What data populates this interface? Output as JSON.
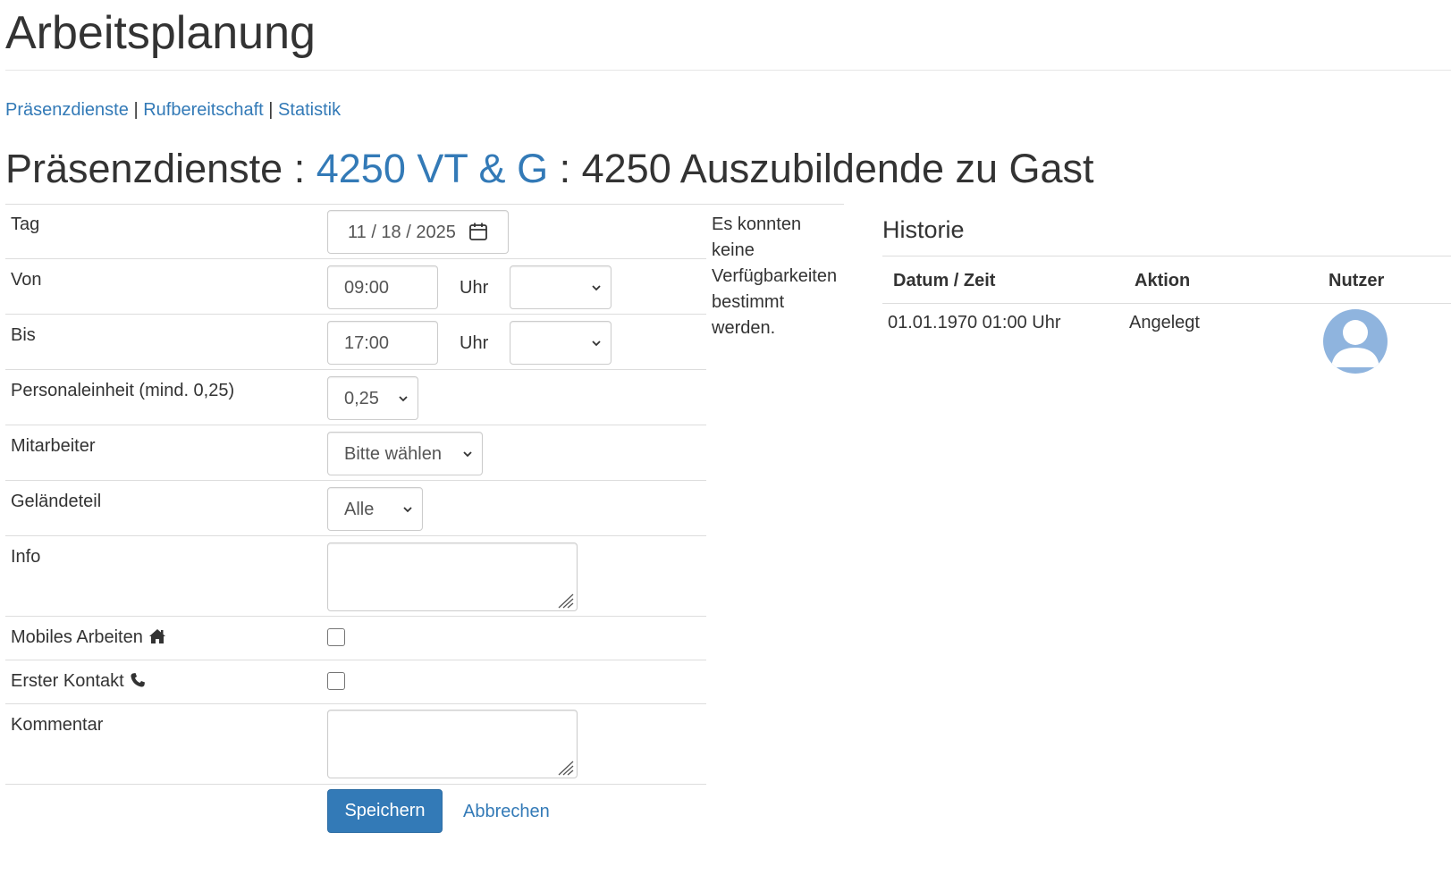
{
  "page": {
    "title": "Arbeitsplanung",
    "nav": [
      {
        "label": "Präsenzdienste"
      },
      {
        "label": "Rufbereitschaft"
      },
      {
        "label": "Statistik"
      }
    ],
    "nav_separator": "|"
  },
  "section": {
    "prefix": "Präsenzdienste",
    "separator": ":",
    "link": "4250 VT & G",
    "suffix": "4250 Auszubildende zu Gast"
  },
  "form": {
    "tag": {
      "label": "Tag",
      "value": "11 / 18 / 2025"
    },
    "von": {
      "label": "Von",
      "value": "09:00",
      "unit": "Uhr",
      "select_value": ""
    },
    "bis": {
      "label": "Bis",
      "value": "17:00",
      "unit": "Uhr",
      "select_value": ""
    },
    "personaleinheit": {
      "label": "Personaleinheit (mind. 0,25)",
      "value": "0,25"
    },
    "mitarbeiter": {
      "label": "Mitarbeiter",
      "value": "Bitte wählen"
    },
    "gelaendeteil": {
      "label": "Geländeteil",
      "value": "Alle"
    },
    "info": {
      "label": "Info",
      "value": ""
    },
    "mobiles_arbeiten": {
      "label": "Mobiles Arbeiten",
      "checked": false,
      "icon": "home-icon"
    },
    "erster_kontakt": {
      "label": "Erster Kontakt",
      "checked": false,
      "icon": "phone-icon"
    },
    "kommentar": {
      "label": "Kommentar",
      "value": ""
    },
    "save_label": "Speichern",
    "cancel_label": "Abbrechen"
  },
  "notice": "Es konnten keine Verfügbarkeiten bestimmt werden.",
  "history": {
    "title": "Historie",
    "columns": [
      "Datum / Zeit",
      "Aktion",
      "Nutzer"
    ],
    "rows": [
      {
        "datetime": "01.01.1970 01:00 Uhr",
        "action": "Angelegt",
        "user_icon": "user-avatar-icon"
      }
    ]
  },
  "colors": {
    "link": "#337ab7",
    "primary_button": "#337ab7",
    "avatar": "#8fb4de",
    "text": "#333333",
    "border": "#dddddd"
  }
}
